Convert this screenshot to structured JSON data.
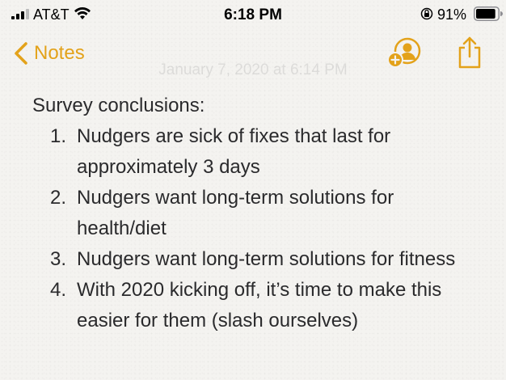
{
  "status_bar": {
    "carrier": "AT&T",
    "time": "6:18 PM",
    "battery_percent": "91%",
    "battery_level": 0.91
  },
  "nav": {
    "back_label": "Notes",
    "accent_color": "#e3a21a",
    "collaborate_icon": "add-person-icon",
    "share_icon": "share-icon"
  },
  "note": {
    "date": "January 7, 2020 at 6:14 PM",
    "heading": "Survey conclusions:",
    "items": [
      {
        "number": "1.",
        "text": "Nudgers are sick of fixes that last for approximately 3 days"
      },
      {
        "number": "2.",
        "text": "Nudgers want long-term solutions for health/diet"
      },
      {
        "number": "3.",
        "text": "Nudgers want long-term solutions for fitness"
      },
      {
        "number": "4.",
        "text": "With 2020 kicking off, it’s time to make this easier for them (slash ourselves)"
      }
    ]
  }
}
